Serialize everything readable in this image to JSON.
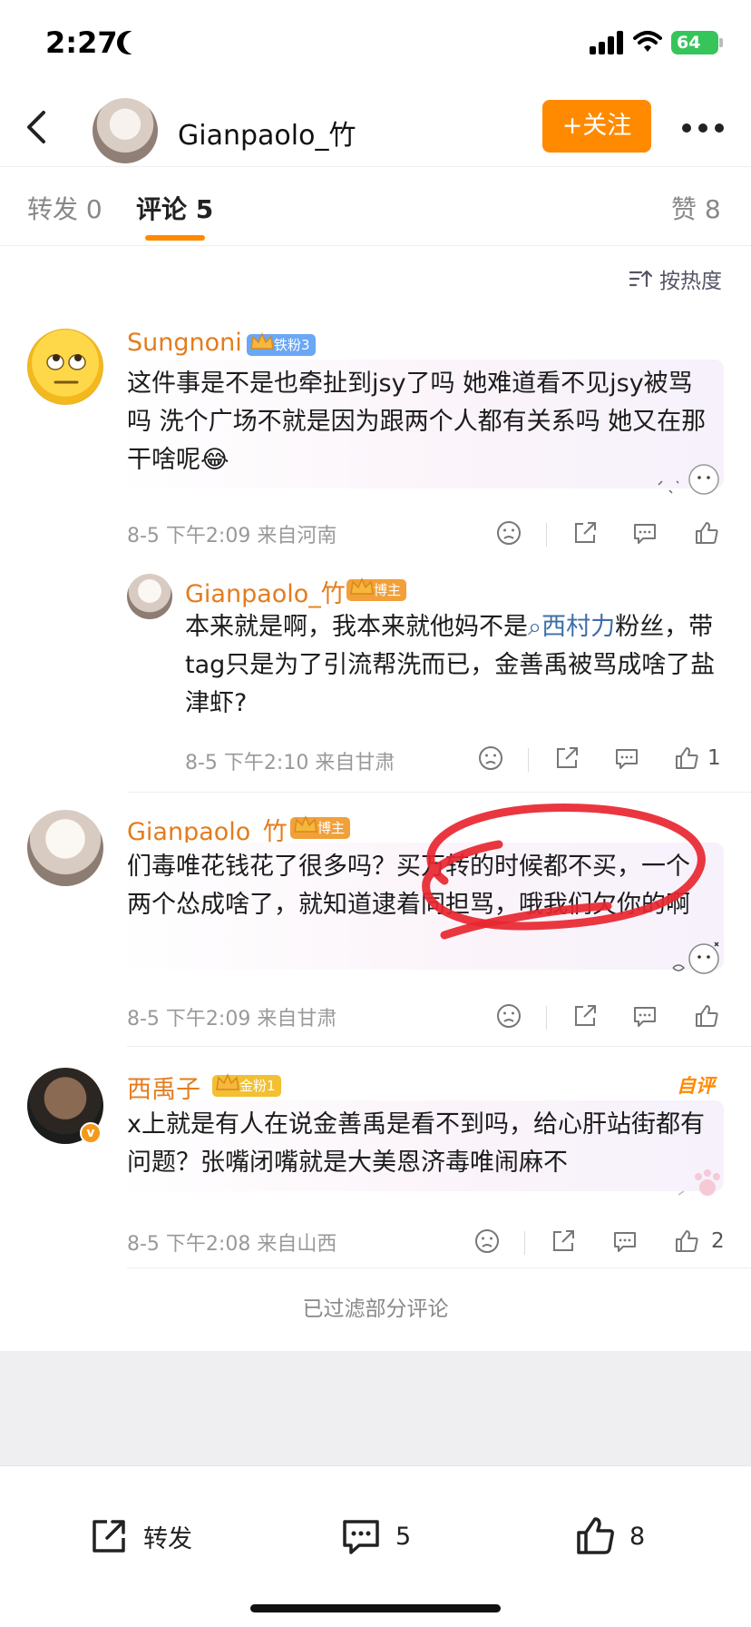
{
  "status_bar": {
    "time": "2:27",
    "battery": "64"
  },
  "header": {
    "username": "Gianpaolo_竹",
    "follow_label": "+关注"
  },
  "tabs": [
    {
      "label": "转发",
      "count": "0"
    },
    {
      "label": "评论",
      "count": "5"
    },
    {
      "label": "赞",
      "count": "8"
    }
  ],
  "sort_label": "按热度",
  "comments": [
    {
      "username": "Sungnoni",
      "badge": "铁粉3",
      "text": "这件事是不是也牵扯到jsy了吗 她难道看不见jsy被骂吗 洗个广场不就是因为跟两个人都有关系吗 她又在那干啥呢",
      "emoji": "😂",
      "meta": "8-5 下午2:09 来自河南",
      "reply": {
        "username": "Gianpaolo_竹",
        "badge": "博主",
        "text_before": "本来就是啊，我本来就他妈不是",
        "topic": "西村力",
        "text_after": "粉丝，带tag只是为了引流帮洗而已，金善禹被骂成啥了盐津虾?",
        "meta": "8-5 下午2:10 来自甘肃",
        "likes": "1"
      }
    },
    {
      "username": "Gianpaolo_竹",
      "badge": "博主",
      "text": "们毒唯花钱花了很多吗？买万转的时候都不买，一个两个怂成啥了，就知道逮着同担骂，哦我们欠你的啊",
      "meta": "8-5 下午2:09 来自甘肃"
    },
    {
      "username": "西禹子",
      "badge": "金粉1",
      "editor_pick": "自评",
      "text": "x上就是有人在说金善禹是看不到吗，给心肝站街都有问题？张嘴闭嘴就是大美恩济毒唯闹麻不",
      "meta": "8-5 下午2:08 来自山西",
      "likes": "2"
    }
  ],
  "filtered_note": "已过滤部分评论",
  "bottom_bar": {
    "repost_label": "转发",
    "comment_count": "5",
    "like_count": "8"
  },
  "colors": {
    "accent": "#ff8a00",
    "username": "#e47c1d",
    "annotation": "#e8262f"
  }
}
